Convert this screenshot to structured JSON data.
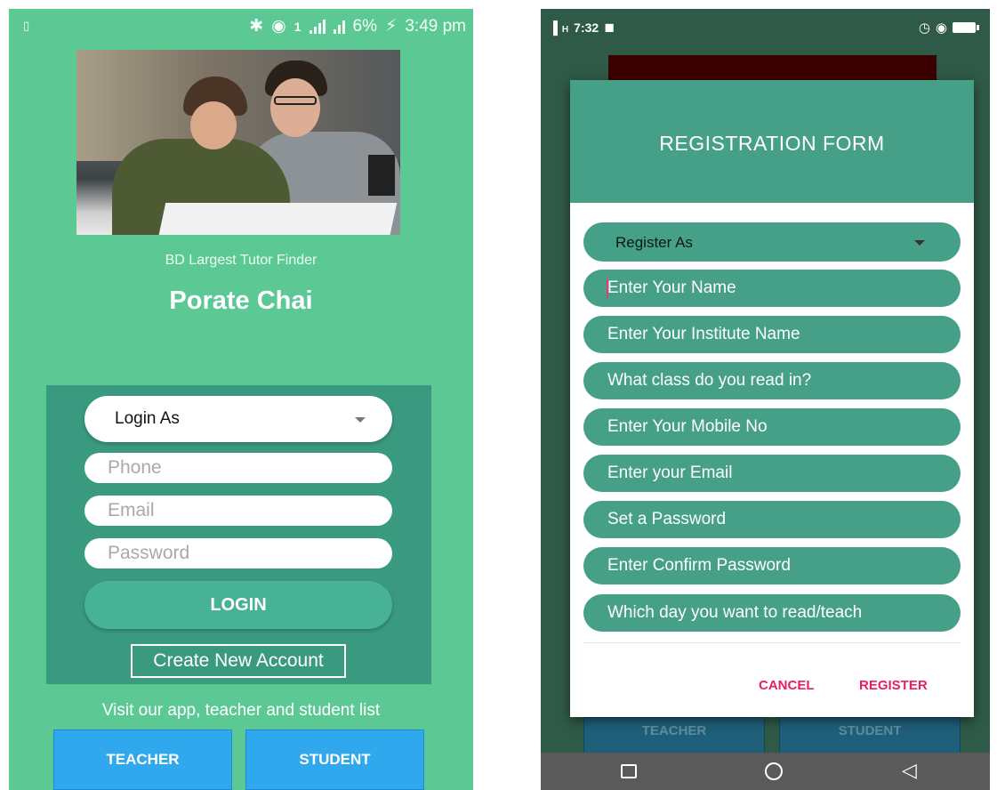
{
  "left_screen": {
    "status": {
      "left_icon": "notification-icon",
      "icons": [
        "bluetooth-icon",
        "wifi-icon",
        "sim-icon",
        "signal-icon",
        "signal-icon"
      ],
      "battery": "6%",
      "time": "3:49 pm"
    },
    "tagline": "BD Largest Tutor Finder",
    "app_title": "Porate Chai",
    "login": {
      "login_as_label": "Login As",
      "phone_placeholder": "Phone",
      "email_placeholder": "Email",
      "password_placeholder": "Password",
      "login_button": "LOGIN",
      "create_account_link": "Create New Account"
    },
    "visit_text": "Visit our app, teacher and student list",
    "teacher_button": "TEACHER",
    "student_button": "STUDENT",
    "colors": {
      "background": "#5cc995",
      "card": "#3a9a80",
      "login_button": "#48b296",
      "bottom_buttons": "#2fa8ee"
    }
  },
  "right_screen": {
    "status": {
      "signal": "H",
      "time": "7:32",
      "right_icons": [
        "alarm-icon",
        "wifi-icon",
        "battery-icon"
      ]
    },
    "dialog": {
      "title": "REGISTRATION FORM",
      "register_as_label": "Register As",
      "fields": [
        "Enter Your Name",
        "Enter Your Institute Name",
        "What class do you read in?",
        "Enter Your Mobile No",
        "Enter your Email",
        "Set a Password",
        "Enter Confirm Password",
        "Which day you want to read/teach"
      ],
      "cancel_button": "CANCEL",
      "register_button": "REGISTER"
    },
    "behind_teacher_button": "TEACHER",
    "behind_student_button": "STUDENT",
    "nav_icons": [
      "recent-apps-icon",
      "home-icon",
      "back-icon"
    ],
    "colors": {
      "header": "#45a087",
      "accent_button_text": "#e91e63",
      "scrim_background": "#2f5a47"
    }
  }
}
